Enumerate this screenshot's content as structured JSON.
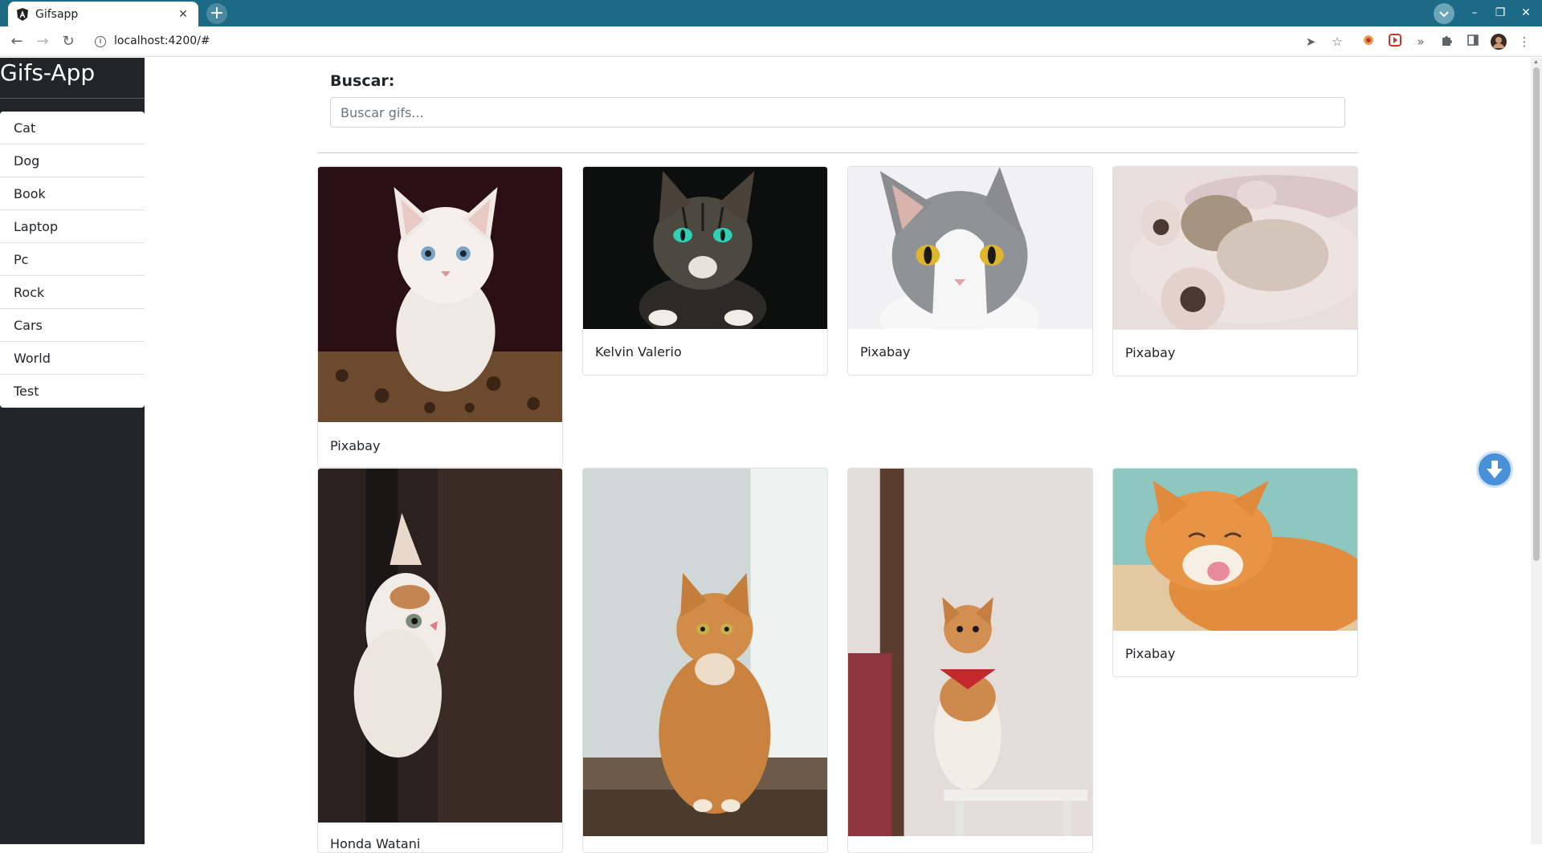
{
  "browser": {
    "tab_title": "Gifsapp",
    "tab_close": "✕",
    "new_tab": "+",
    "url": "localhost:4200/#"
  },
  "sidebar": {
    "brand": "Gifs-App",
    "items": [
      {
        "label": "Cat"
      },
      {
        "label": "Dog"
      },
      {
        "label": "Book"
      },
      {
        "label": "Laptop"
      },
      {
        "label": "Pc"
      },
      {
        "label": "Rock"
      },
      {
        "label": "Cars"
      },
      {
        "label": "World"
      },
      {
        "label": "Test"
      }
    ]
  },
  "search": {
    "label": "Buscar:",
    "placeholder": "Buscar gifs...",
    "value": ""
  },
  "cards": [
    {
      "caption": "Pixabay"
    },
    {
      "caption": "Kelvin Valerio"
    },
    {
      "caption": "Pixabay"
    },
    {
      "caption": "Pixabay"
    },
    {
      "caption": "Honda Watani"
    },
    {
      "caption": ""
    },
    {
      "caption": ""
    },
    {
      "caption": "Pixabay"
    }
  ],
  "colors": {
    "tabbar": "#1c6a85",
    "sidebar": "#212529",
    "scroll_button": "#4a90d9"
  }
}
